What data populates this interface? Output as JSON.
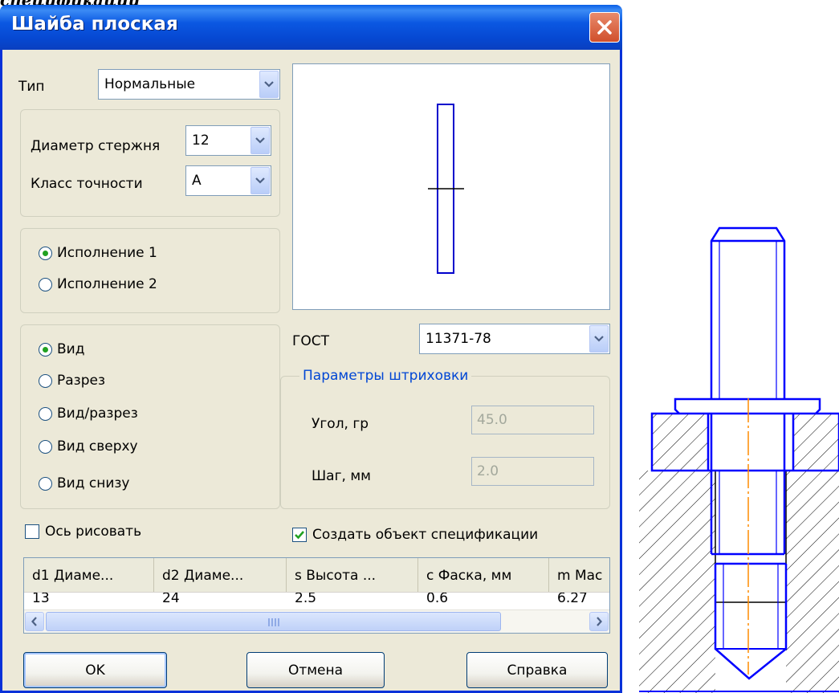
{
  "page_caption": "спецификации",
  "dialog": {
    "title": "Шайба плоская",
    "type_label": "Тип",
    "type_value": "Нормальные",
    "rod_diameter_label": "Диаметр стержня",
    "rod_diameter_value": "12",
    "accuracy_class_label": "Класс точности",
    "accuracy_class_value": "А",
    "execution_options": [
      {
        "label": "Исполнение 1",
        "selected": true
      },
      {
        "label": "Исполнение 2",
        "selected": false
      }
    ],
    "view_options": [
      {
        "label": "Вид",
        "selected": true
      },
      {
        "label": "Разрез",
        "selected": false
      },
      {
        "label": "Вид/разрез",
        "selected": false
      },
      {
        "label": "Вид сверху",
        "selected": false
      },
      {
        "label": "Вид снизу",
        "selected": false
      }
    ],
    "gost_label": "ГОСТ",
    "gost_value": "11371-78",
    "hatch_group_title": "Параметры штриховки",
    "hatch_angle_label": "Угол, гр",
    "hatch_angle_value": "45.0",
    "hatch_step_label": "Шаг, мм",
    "hatch_step_value": "2.0",
    "draw_axis_label": "Ось рисовать",
    "draw_axis_checked": false,
    "create_spec_label": "Создать объект спецификации",
    "create_spec_checked": true,
    "table": {
      "columns": [
        "d1 Диаме...",
        "d2 Диаме...",
        "s Высота ...",
        "c Фаска, мм",
        "m Mac"
      ],
      "row": [
        "13",
        "24",
        "2.5",
        "0.6",
        "6.27"
      ]
    },
    "buttons": {
      "ok": "OK",
      "cancel": "Отмена",
      "help": "Справка"
    }
  },
  "colors": {
    "titlebar": "#0b58e2",
    "dialog_bg": "#ece9d8",
    "drawing_blue": "#0000ff",
    "axis_orange": "#ff8c00",
    "preview_line": "#0000cc"
  }
}
